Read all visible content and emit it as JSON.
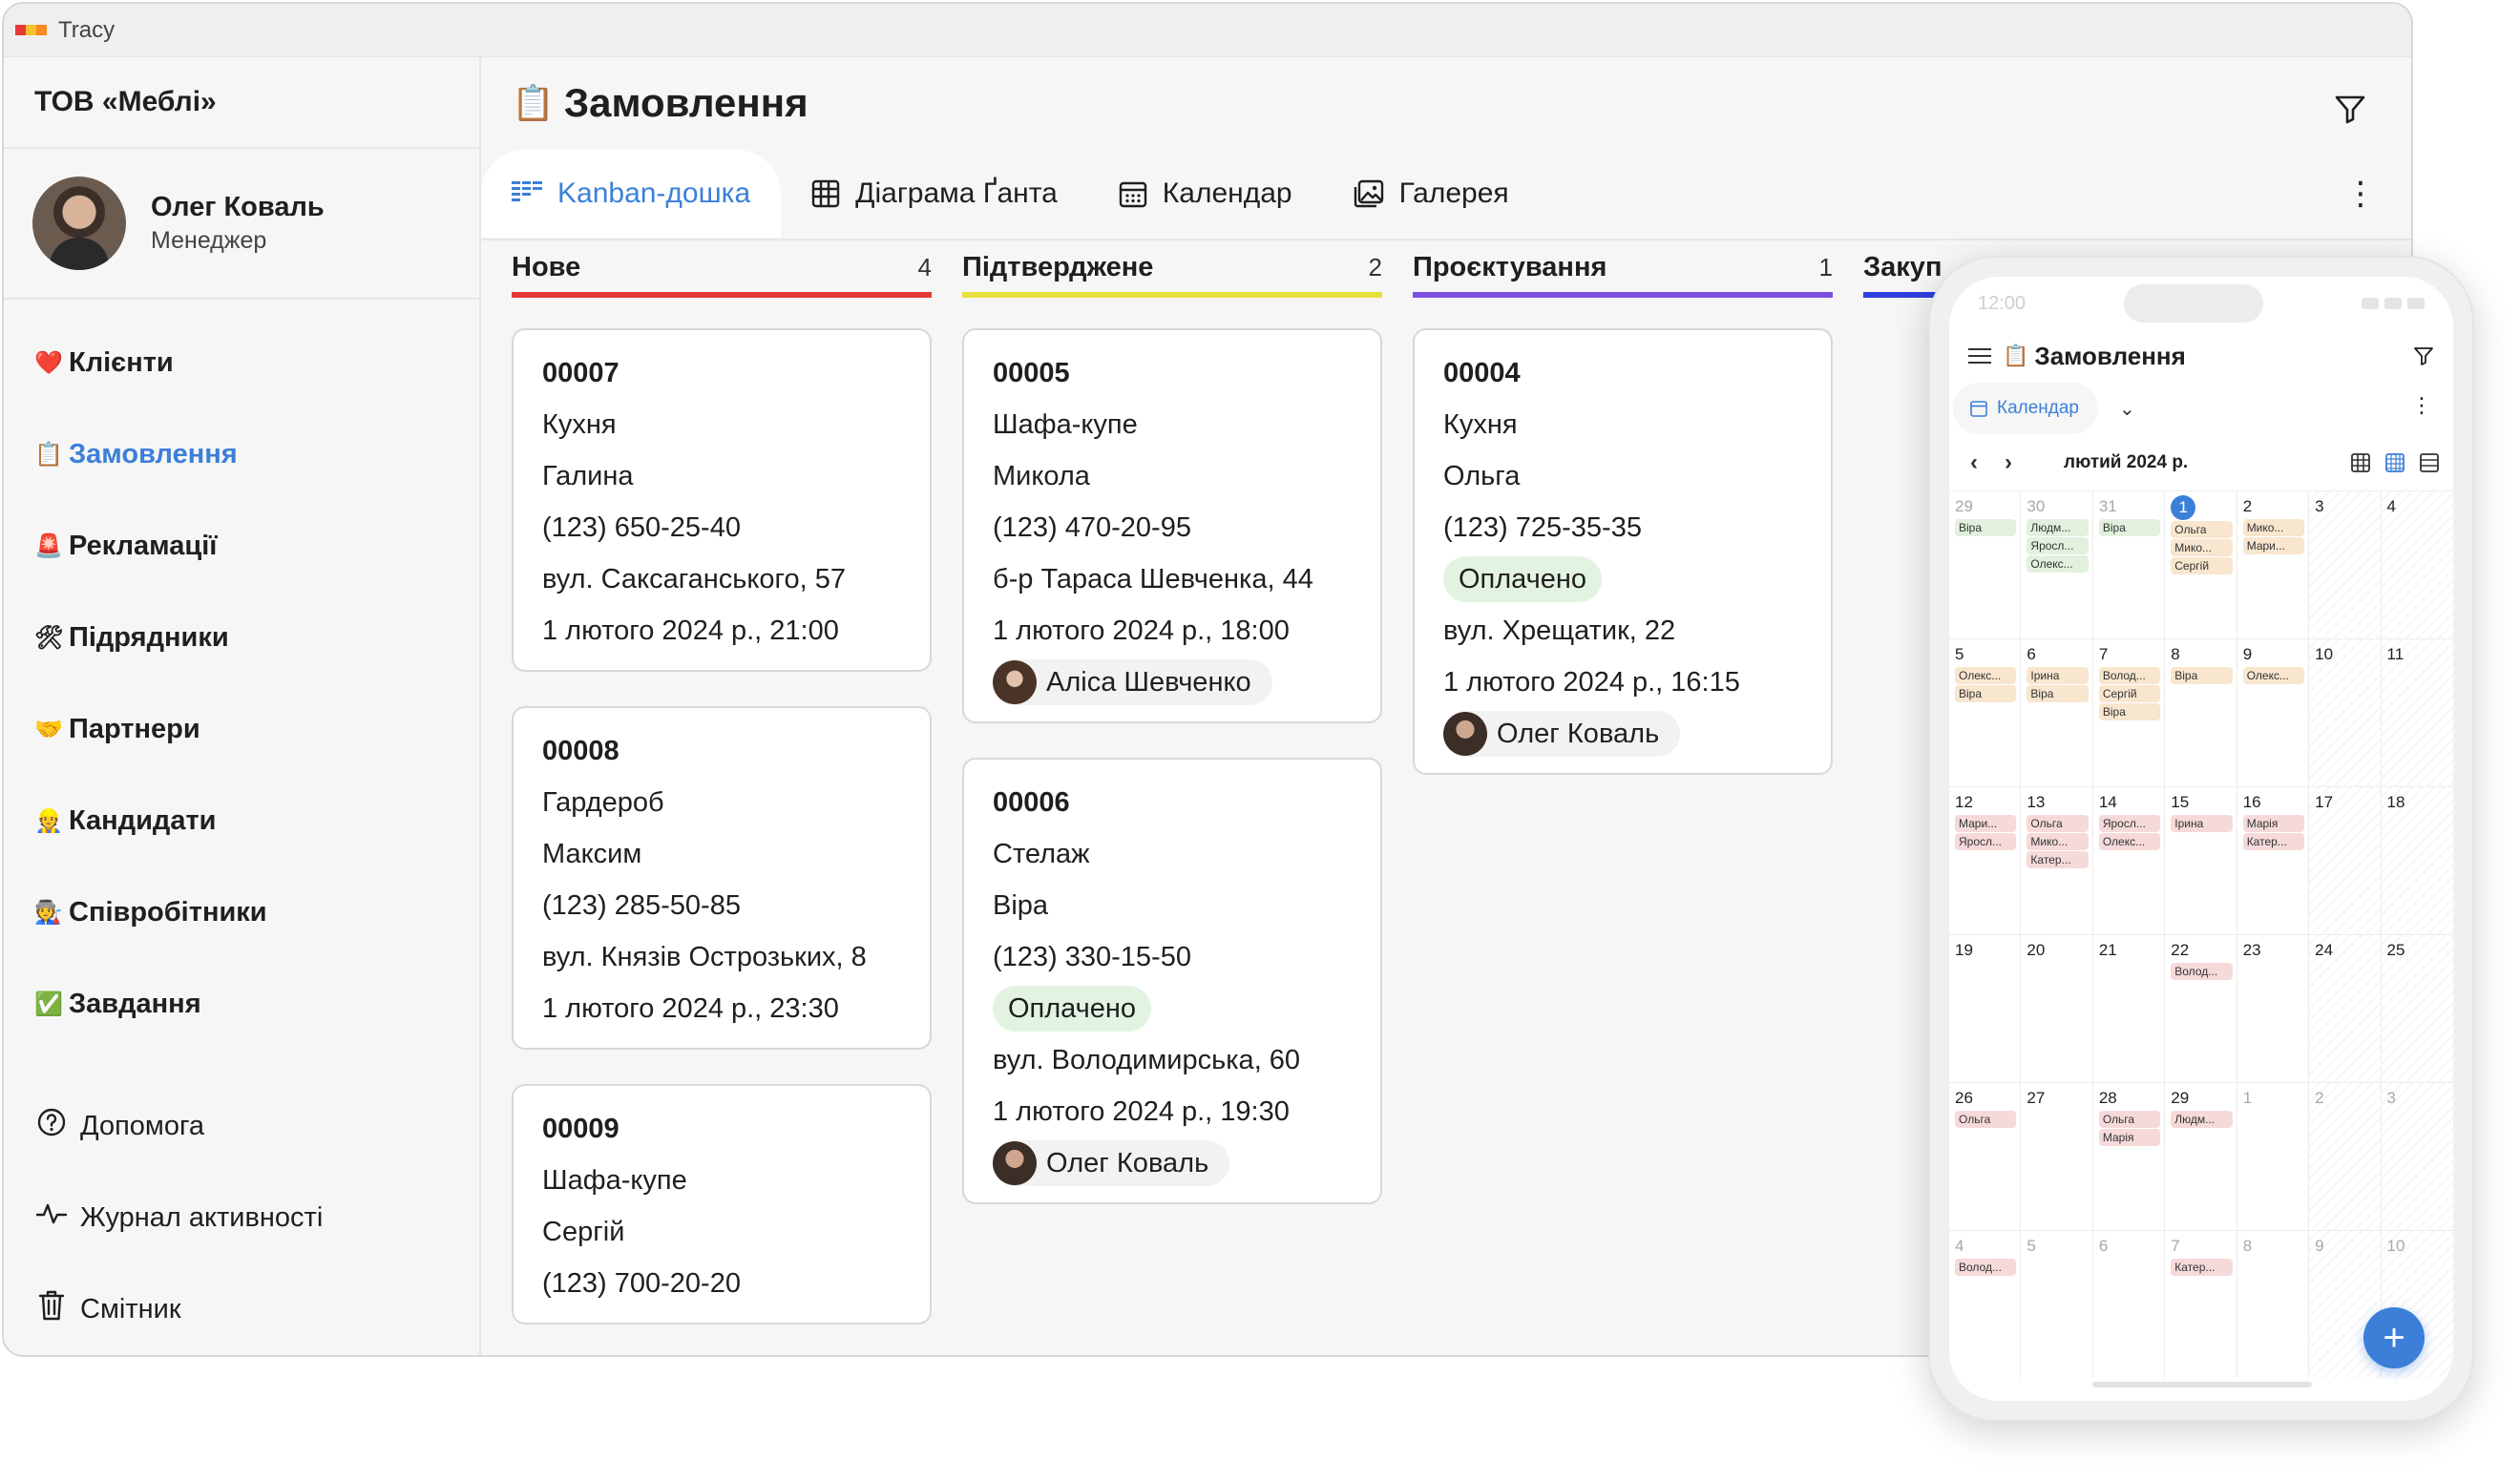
{
  "app": {
    "title": "Tracy",
    "logo_colors": [
      "#e53935",
      "#f6c12b",
      "#f58a1f"
    ]
  },
  "sidebar": {
    "company": "ТОВ «Меблі»",
    "user": {
      "name": "Олег Коваль",
      "role": "Менеджер"
    },
    "items": [
      {
        "icon": "❤️",
        "label": "Клієнти"
      },
      {
        "icon": "📋",
        "label": "Замовлення"
      },
      {
        "icon": "🚨",
        "label": "Рекламації"
      },
      {
        "icon": "🛠",
        "label": "Підрядники"
      },
      {
        "icon": "🤝",
        "label": "Партнери"
      },
      {
        "icon": "👷",
        "label": "Кандидати"
      },
      {
        "icon": "🧑‍🏭",
        "label": "Співробітники"
      },
      {
        "icon": "✅",
        "label": "Завдання"
      }
    ],
    "bottom": [
      {
        "icon": "help-circle-icon",
        "label": "Допомога"
      },
      {
        "icon": "activity-icon",
        "label": "Журнал активності"
      },
      {
        "icon": "trash-icon",
        "label": "Смітник"
      }
    ]
  },
  "main": {
    "title_icon": "📋",
    "title": "Замовлення",
    "tabs": [
      {
        "label": "Kanban-дошка",
        "icon": "kanban-icon"
      },
      {
        "label": "Діаграма Ґанта",
        "icon": "gantt-icon"
      },
      {
        "label": "Календар",
        "icon": "calendar-icon"
      },
      {
        "label": "Галерея",
        "icon": "gallery-icon"
      }
    ]
  },
  "columns": [
    {
      "title": "Нове",
      "count": "4",
      "color": "#e53935",
      "cards": [
        {
          "id": "00007",
          "product": "Кухня",
          "client": "Галина",
          "phone": "(123) 650-25-40",
          "address": "вул. Саксаганського, 57",
          "date": "1 лютого 2024 р., 21:00"
        },
        {
          "id": "00008",
          "product": "Гардероб",
          "client": "Максим",
          "phone": "(123) 285-50-85",
          "address": "вул. Князів Острозьких, 8",
          "date": "1 лютого 2024 р., 23:30"
        },
        {
          "id": "00009",
          "product": "Шафа-купе",
          "client": "Сергій",
          "phone": "(123) 700-20-20"
        }
      ]
    },
    {
      "title": "Підтверджене",
      "count": "2",
      "color": "#e8e03a",
      "cards": [
        {
          "id": "00005",
          "product": "Шафа-купе",
          "client": "Микола",
          "phone": "(123) 470-20-95",
          "address": "б-р Тараса Шевченка, 44",
          "date": "1 лютого 2024 р., 18:00",
          "person": "Аліса Шевченко"
        },
        {
          "id": "00006",
          "product": "Стелаж",
          "client": "Віра",
          "phone": "(123) 330-15-50",
          "badge": "Оплачено",
          "address": "вул. Володимирська, 60",
          "date": "1 лютого 2024 р., 19:30",
          "person": "Олег Коваль"
        }
      ]
    },
    {
      "title": "Проєктування",
      "count": "1",
      "color": "#7b4fe0",
      "cards": [
        {
          "id": "00004",
          "product": "Кухня",
          "client": "Ольга",
          "phone": "(123) 725-35-35",
          "badge": "Оплачено",
          "address": "вул. Хрещатик, 22",
          "date": "1 лютого 2024 р., 16:15",
          "person": "Олег Коваль"
        }
      ]
    },
    {
      "title": "Закуп",
      "count": "",
      "color": "#2d3ee0",
      "cards": []
    }
  ],
  "mobile": {
    "time": "12:00",
    "title_icon": "📋",
    "title": "Замовлення",
    "view_tab": "Календар",
    "month": "лютий 2024 р.",
    "weeks": [
      [
        {
          "d": "29",
          "o": true,
          "ev": [
            [
              "Віра",
              "g"
            ]
          ]
        },
        {
          "d": "30",
          "o": true,
          "ev": [
            [
              "Людм...",
              "g"
            ],
            [
              "Яросл...",
              "g"
            ],
            [
              "Олекс...",
              "g"
            ]
          ]
        },
        {
          "d": "31",
          "o": true,
          "ev": [
            [
              "Віра",
              "g"
            ]
          ]
        },
        {
          "d": "1",
          "t": true,
          "ev": [
            [
              "Ольга",
              "o"
            ],
            [
              "Мико...",
              "o"
            ],
            [
              "Сергій",
              "o"
            ]
          ]
        },
        {
          "d": "2",
          "ev": [
            [
              "Мико...",
              "o"
            ],
            [
              "Мари...",
              "o"
            ]
          ]
        },
        {
          "d": "3",
          "w": true,
          "ev": []
        },
        {
          "d": "4",
          "w": true,
          "ev": []
        }
      ],
      [
        {
          "d": "5",
          "ev": [
            [
              "Олекс...",
              "o"
            ],
            [
              "Віра",
              "o"
            ]
          ]
        },
        {
          "d": "6",
          "ev": [
            [
              "Ірина",
              "o"
            ],
            [
              "Віра",
              "o"
            ]
          ]
        },
        {
          "d": "7",
          "ev": [
            [
              "Волод...",
              "o"
            ],
            [
              "Сергій",
              "o"
            ],
            [
              "Віра",
              "o"
            ]
          ]
        },
        {
          "d": "8",
          "ev": [
            [
              "Віра",
              "o"
            ]
          ]
        },
        {
          "d": "9",
          "ev": [
            [
              "Олекс...",
              "o"
            ]
          ]
        },
        {
          "d": "10",
          "w": true,
          "ev": []
        },
        {
          "d": "11",
          "w": true,
          "ev": []
        }
      ],
      [
        {
          "d": "12",
          "ev": [
            [
              "Мари...",
              "r"
            ],
            [
              "Яросл...",
              "r"
            ]
          ]
        },
        {
          "d": "13",
          "ev": [
            [
              "Ольга",
              "r"
            ],
            [
              "Мико...",
              "r"
            ],
            [
              "Катер...",
              "r"
            ]
          ]
        },
        {
          "d": "14",
          "ev": [
            [
              "Яросл...",
              "r"
            ],
            [
              "Олекс...",
              "r"
            ]
          ]
        },
        {
          "d": "15",
          "ev": [
            [
              "Ірина",
              "r"
            ]
          ]
        },
        {
          "d": "16",
          "ev": [
            [
              "Марія",
              "r"
            ],
            [
              "Катер...",
              "r"
            ]
          ]
        },
        {
          "d": "17",
          "w": true,
          "ev": []
        },
        {
          "d": "18",
          "w": true,
          "ev": []
        }
      ],
      [
        {
          "d": "19",
          "ev": []
        },
        {
          "d": "20",
          "ev": []
        },
        {
          "d": "21",
          "ev": []
        },
        {
          "d": "22",
          "ev": [
            [
              "Волод...",
              "r"
            ]
          ]
        },
        {
          "d": "23",
          "ev": []
        },
        {
          "d": "24",
          "w": true,
          "ev": []
        },
        {
          "d": "25",
          "w": true,
          "ev": []
        }
      ],
      [
        {
          "d": "26",
          "ev": [
            [
              "Ольга",
              "r"
            ]
          ]
        },
        {
          "d": "27",
          "ev": []
        },
        {
          "d": "28",
          "ev": [
            [
              "Ольга",
              "r"
            ],
            [
              "Марія",
              "r"
            ]
          ]
        },
        {
          "d": "29",
          "ev": [
            [
              "Людм...",
              "r"
            ]
          ]
        },
        {
          "d": "1",
          "o": true,
          "ev": []
        },
        {
          "d": "2",
          "o": true,
          "w": true,
          "ev": []
        },
        {
          "d": "3",
          "o": true,
          "w": true,
          "ev": []
        }
      ],
      [
        {
          "d": "4",
          "o": true,
          "ev": [
            [
              "Волод...",
              "r"
            ]
          ]
        },
        {
          "d": "5",
          "o": true,
          "ev": []
        },
        {
          "d": "6",
          "o": true,
          "ev": []
        },
        {
          "d": "7",
          "o": true,
          "ev": [
            [
              "Катер...",
              "r"
            ]
          ]
        },
        {
          "d": "8",
          "o": true,
          "ev": []
        },
        {
          "d": "9",
          "o": true,
          "w": true,
          "ev": []
        },
        {
          "d": "10",
          "o": true,
          "w": true,
          "ev": []
        }
      ]
    ]
  }
}
